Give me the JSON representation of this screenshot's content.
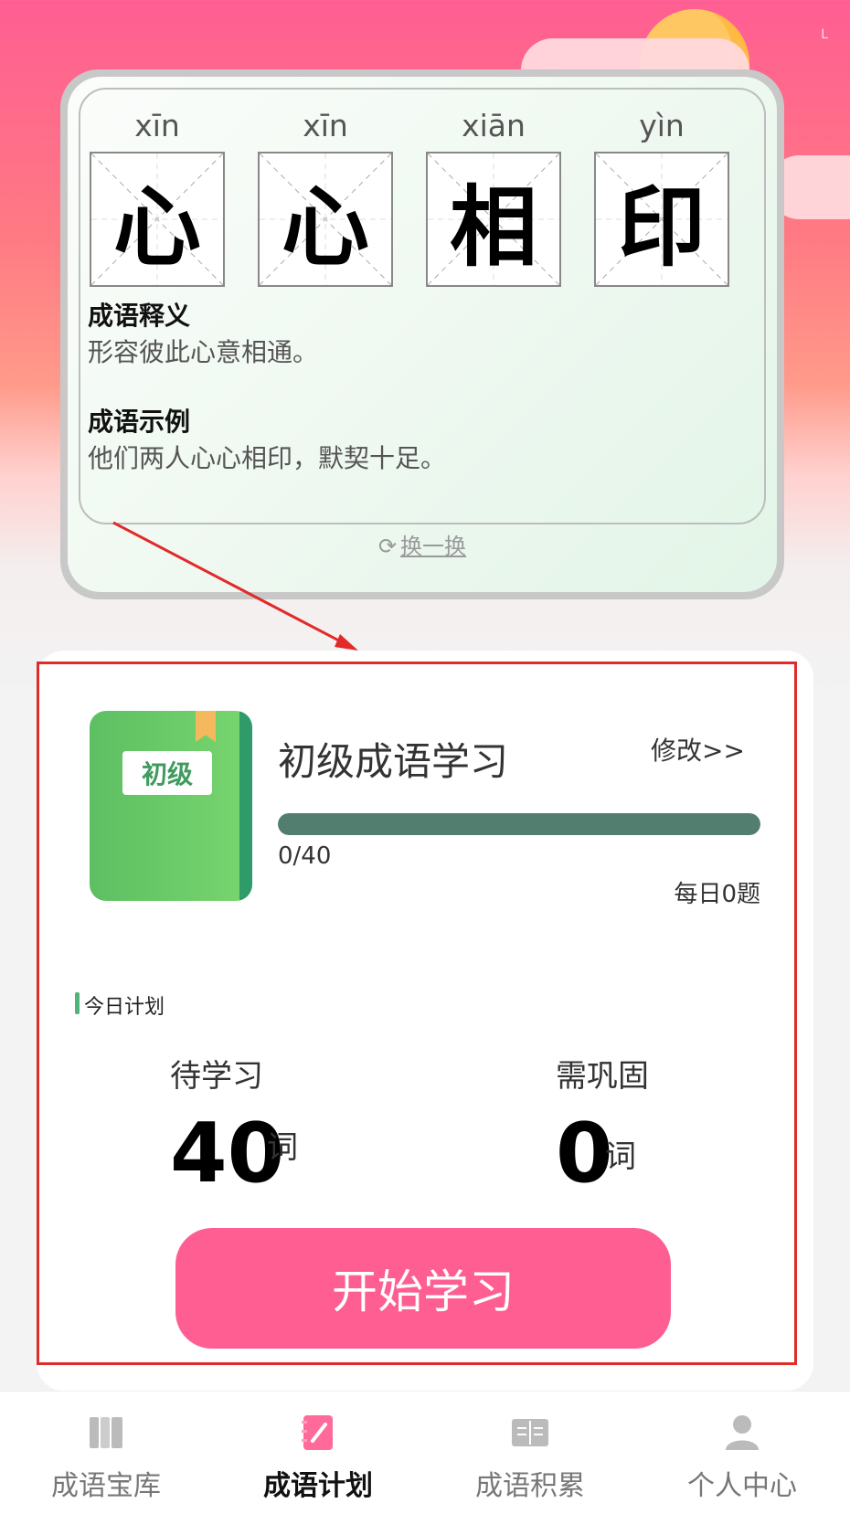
{
  "idiom": {
    "characters": [
      {
        "pinyin": "xīn",
        "char": "心"
      },
      {
        "pinyin": "xīn",
        "char": "心"
      },
      {
        "pinyin": "xiān",
        "char": "相"
      },
      {
        "pinyin": "yìn",
        "char": "印"
      }
    ],
    "definition_title": "成语释义",
    "definition_text": "形容彼此心意相通。",
    "example_title": "成语示例",
    "example_text": "他们两人心心相印，默契十足。",
    "refresh_label": "换一换"
  },
  "plan": {
    "book_tag": "初级",
    "title": "初级成语学习",
    "modify_label": "修改>>",
    "progress_text": "0/40",
    "progress_fraction": 0,
    "daily_text": "每日0题",
    "today_label": "今日计划",
    "to_learn_label": "待学习",
    "to_learn_count": "40",
    "to_learn_unit": "词",
    "review_label": "需巩固",
    "review_count": "0",
    "review_unit": "词",
    "start_button": "开始学习"
  },
  "nav": {
    "items": [
      {
        "label": "成语宝库",
        "icon": "book-shelf-icon"
      },
      {
        "label": "成语计划",
        "icon": "notebook-pencil-icon"
      },
      {
        "label": "成语积累",
        "icon": "open-book-icon"
      },
      {
        "label": "个人中心",
        "icon": "person-icon"
      }
    ]
  },
  "status": {
    "mark": "L"
  },
  "colors": {
    "accent": "#ff5e93",
    "progress_fill": "#527e70",
    "highlight": "#e12a2a"
  }
}
